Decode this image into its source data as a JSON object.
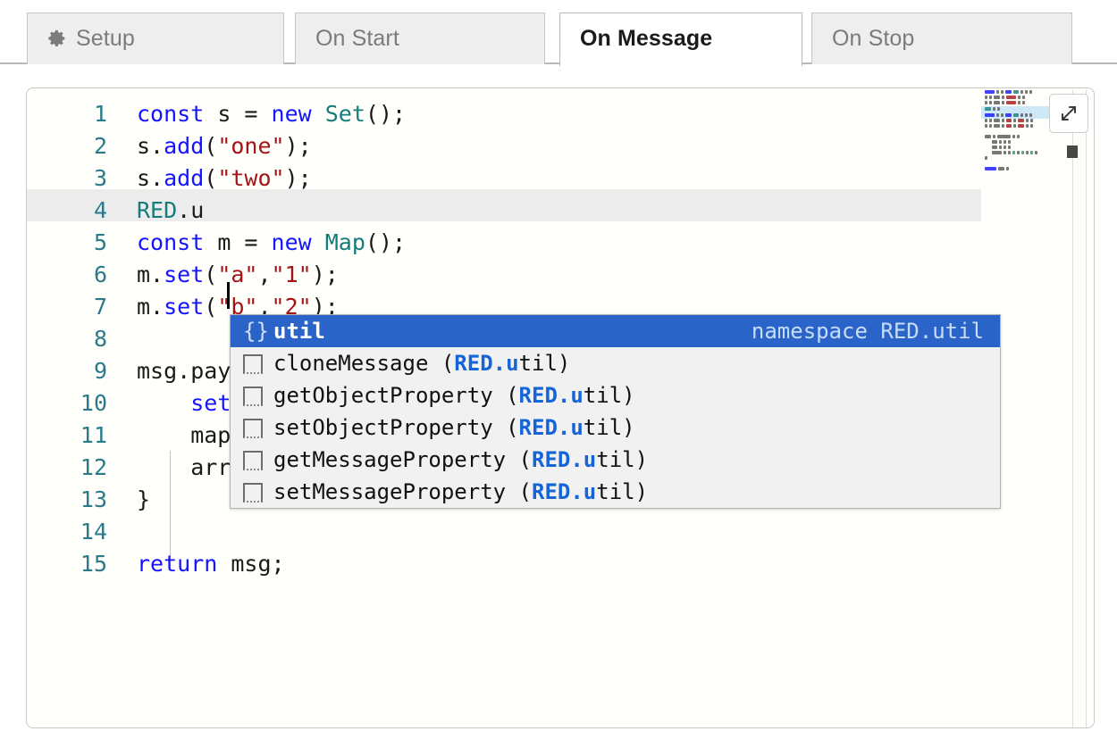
{
  "tabs": [
    {
      "label": "Setup",
      "icon": "gear-icon",
      "active": false
    },
    {
      "label": "On Start",
      "icon": "",
      "active": false
    },
    {
      "label": "On Message",
      "icon": "",
      "active": true
    },
    {
      "label": "On Stop",
      "icon": "",
      "active": false
    }
  ],
  "editor": {
    "line_numbers": [
      "1",
      "2",
      "3",
      "4",
      "5",
      "6",
      "7",
      "8",
      "9",
      "10",
      "11",
      "12",
      "13",
      "14",
      "15"
    ],
    "lines": [
      "const s = new Set();",
      "s.add(\"one\");",
      "s.add(\"two\");",
      "RED.u",
      "const m = new Map();",
      "m.set(\"a\",\"1\");",
      "m.set(\"b\",\"2\");",
      "",
      "msg.payload = {",
      "    set: s,",
      "    map: m,",
      "    array: [1,2,3]",
      "}",
      "",
      "return msg;"
    ],
    "cursor_line": "4",
    "cursor_text": "RED.u"
  },
  "autocomplete": {
    "selected_index": 0,
    "items": [
      {
        "icon": "braces-icon",
        "name": "util",
        "match": "",
        "rest": "",
        "meta": "namespace RED.util"
      },
      {
        "icon": "property-icon",
        "name": "cloneMessage",
        "match": "RED.u",
        "rest": "til",
        "meta": ""
      },
      {
        "icon": "property-icon",
        "name": "getObjectProperty",
        "match": "RED.u",
        "rest": "til",
        "meta": ""
      },
      {
        "icon": "property-icon",
        "name": "setObjectProperty",
        "match": "RED.u",
        "rest": "til",
        "meta": ""
      },
      {
        "icon": "property-icon",
        "name": "getMessageProperty",
        "match": "RED.u",
        "rest": "til",
        "meta": ""
      },
      {
        "icon": "property-icon",
        "name": "setMessageProperty",
        "match": "RED.u",
        "rest": "til",
        "meta": ""
      }
    ],
    "braces_glyph": "{}",
    "paren_open": " (",
    "paren_close": ")"
  },
  "controls": {
    "expand_button_label": "expand-icon"
  },
  "colors": {
    "accent_blue": "#2a64c8",
    "keyword": "#1414ff",
    "class": "#157c7c",
    "string": "#a31515",
    "number": "#1a9a5a",
    "lineno": "#2b7a8c",
    "match_highlight": "#1565d8",
    "active_line": "#ececec"
  }
}
